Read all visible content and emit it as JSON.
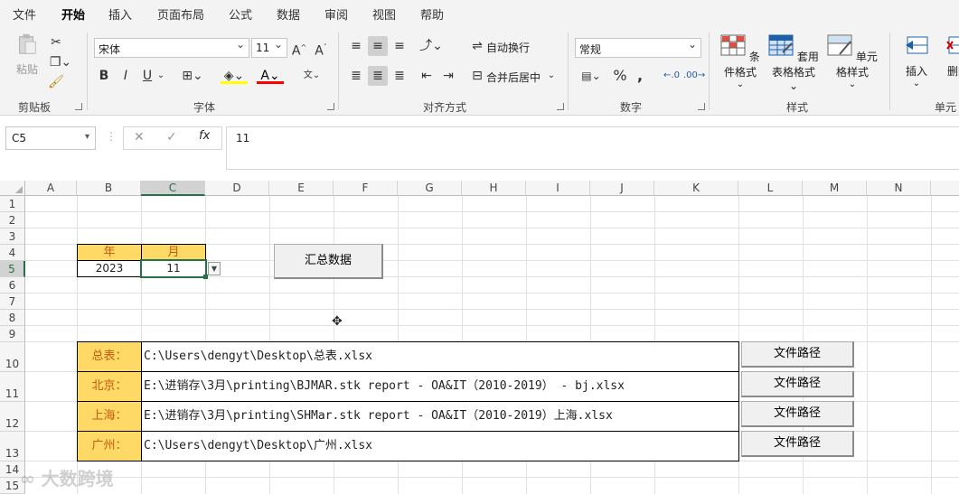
{
  "tabs": [
    "文件",
    "开始",
    "插入",
    "页面布局",
    "公式",
    "数据",
    "审阅",
    "视图",
    "帮助"
  ],
  "active_tab": "开始",
  "ribbon": {
    "clipboard": {
      "paste_label": "粘贴",
      "group_label": "剪贴板"
    },
    "font": {
      "font_name": "宋体",
      "font_size": "11",
      "group_label": "字体",
      "bold": "B",
      "italic": "I",
      "underline": "U"
    },
    "alignment": {
      "wrap_label": "自动换行",
      "merge_label": "合并后居中",
      "group_label": "对齐方式"
    },
    "number": {
      "format": "常规",
      "group_label": "数字"
    },
    "styles": {
      "cond_format": "条件格式",
      "table_format_1": "套用",
      "table_format_2": "表格格式",
      "cell_style": "单元格样式",
      "group_label": "样式"
    },
    "cells": {
      "insert": "插入",
      "delete": "删除",
      "group_label": "单元"
    }
  },
  "formula_bar": {
    "name_box": "C5",
    "fx": "fx",
    "value": "11"
  },
  "columns": [
    "A",
    "B",
    "C",
    "D",
    "E",
    "F",
    "G",
    "H",
    "I",
    "J",
    "K",
    "L",
    "M",
    "N"
  ],
  "rows": [
    "1",
    "2",
    "3",
    "4",
    "5",
    "6",
    "7",
    "8",
    "9",
    "10",
    "11",
    "12",
    "13",
    "14",
    "15"
  ],
  "selected_cell": "C5",
  "sheet": {
    "year_header": "年",
    "month_header": "月",
    "year_value": "2023",
    "month_value": "11",
    "summary_button": "汇总数据",
    "paths": [
      {
        "label": "总表：",
        "path": "C:\\Users\\dengyt\\Desktop\\总表.xlsx",
        "button": "文件路径"
      },
      {
        "label": "北京：",
        "path": "E:\\进销存\\3月\\printing\\BJMAR.stk report - OA&IT（2010-2019） - bj.xlsx",
        "button": "文件路径"
      },
      {
        "label": "上海：",
        "path": "E:\\进销存\\3月\\printing\\SHMar.stk report - OA&IT（2010-2019）上海.xlsx",
        "button": "文件路径"
      },
      {
        "label": "广州：",
        "path": "C:\\Users\\dengyt\\Desktop\\广州.xlsx",
        "button": "文件路径"
      }
    ]
  },
  "watermark": "大数跨境",
  "colors": {
    "accent": "#217346",
    "yellow_fill": "#ffd966",
    "label_text": "#c55a11"
  }
}
